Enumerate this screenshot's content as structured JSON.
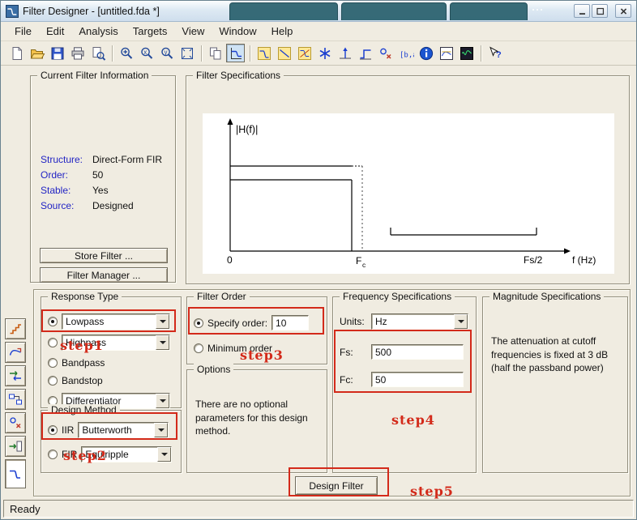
{
  "window": {
    "title": "Filter Designer - [untitled.fda *]",
    "status": "Ready"
  },
  "menu": {
    "items": [
      "File",
      "Edit",
      "Analysis",
      "Targets",
      "View",
      "Window",
      "Help"
    ]
  },
  "toolbar": {
    "pressed": "filter-specifications",
    "items": [
      "new-document",
      "open-file",
      "save",
      "print",
      "print-preview",
      "|",
      "zoom-in",
      "zoom-x",
      "zoom-y",
      "full-view",
      "|",
      "copy",
      "filter-specifications",
      "|",
      "magnitude-response",
      "phase-response",
      "magnitude-phase-response",
      "group-delay",
      "impulse-response",
      "step-response",
      "pole-zero-plot",
      "filter-coefficients",
      "filter-information",
      "overlay-analysis",
      "sptool",
      "|",
      "whats-this-help"
    ]
  },
  "sidebar": {
    "pressed": "design-filter-panel",
    "items": [
      "set-quantization-parameters",
      "transform-filter",
      "multirate-filter",
      "realize-model",
      "pole-zero-editor",
      "import-filter",
      "design-filter-panel"
    ]
  },
  "current_filter_info": {
    "title": "Current Filter Information",
    "rows": [
      {
        "label": "Structure:",
        "value": "Direct-Form FIR"
      },
      {
        "label": "Order:",
        "value": "50"
      },
      {
        "label": "Stable:",
        "value": "Yes"
      },
      {
        "label": "Source:",
        "value": "Designed"
      }
    ],
    "store_button": "Store Filter ...",
    "manager_button": "Filter Manager ..."
  },
  "filter_specifications": {
    "title": "Filter Specifications",
    "y_axis_label": "|H(f)|",
    "x_axis_label": "f (Hz)",
    "tick_zero": "0",
    "tick_fc_main": "F",
    "tick_fc_sub": "c",
    "tick_fs2": "Fs/2"
  },
  "response_type": {
    "title": "Response Type",
    "options": [
      {
        "label": "Lowpass",
        "selected": true
      },
      {
        "label": "Highpass",
        "selected": false
      },
      {
        "label": "Bandpass",
        "selected": false
      },
      {
        "label": "Bandstop",
        "selected": false
      },
      {
        "label": "Differentiator",
        "selected": false
      }
    ]
  },
  "design_method": {
    "title": "Design Method",
    "iir": {
      "label": "IIR",
      "value": "Butterworth",
      "selected": true
    },
    "fir": {
      "label": "FIR",
      "value": "Equiripple",
      "selected": false
    }
  },
  "filter_order": {
    "title": "Filter Order",
    "specify_label": "Specify order:",
    "specify_value": "10",
    "specify_selected": true,
    "minimum_label": "Minimum order",
    "minimum_selected": false
  },
  "options_panel": {
    "title": "Options",
    "text": "There are no optional parameters for this design method."
  },
  "frequency_specifications": {
    "title": "Frequency Specifications",
    "units_label": "Units:",
    "units_value": "Hz",
    "fs_label": "Fs:",
    "fs_value": "500",
    "fc_label": "Fc:",
    "fc_value": "50"
  },
  "magnitude_specifications": {
    "title": "Magnitude Specifications",
    "text": "The attenuation at cutoff frequencies is fixed at 3 dB (half the passband power)"
  },
  "design_action": {
    "button": "Design Filter"
  },
  "annotations": {
    "step1": "step1",
    "step2": "step2",
    "step3": "step3",
    "step4": "step4",
    "step5": "step5"
  }
}
